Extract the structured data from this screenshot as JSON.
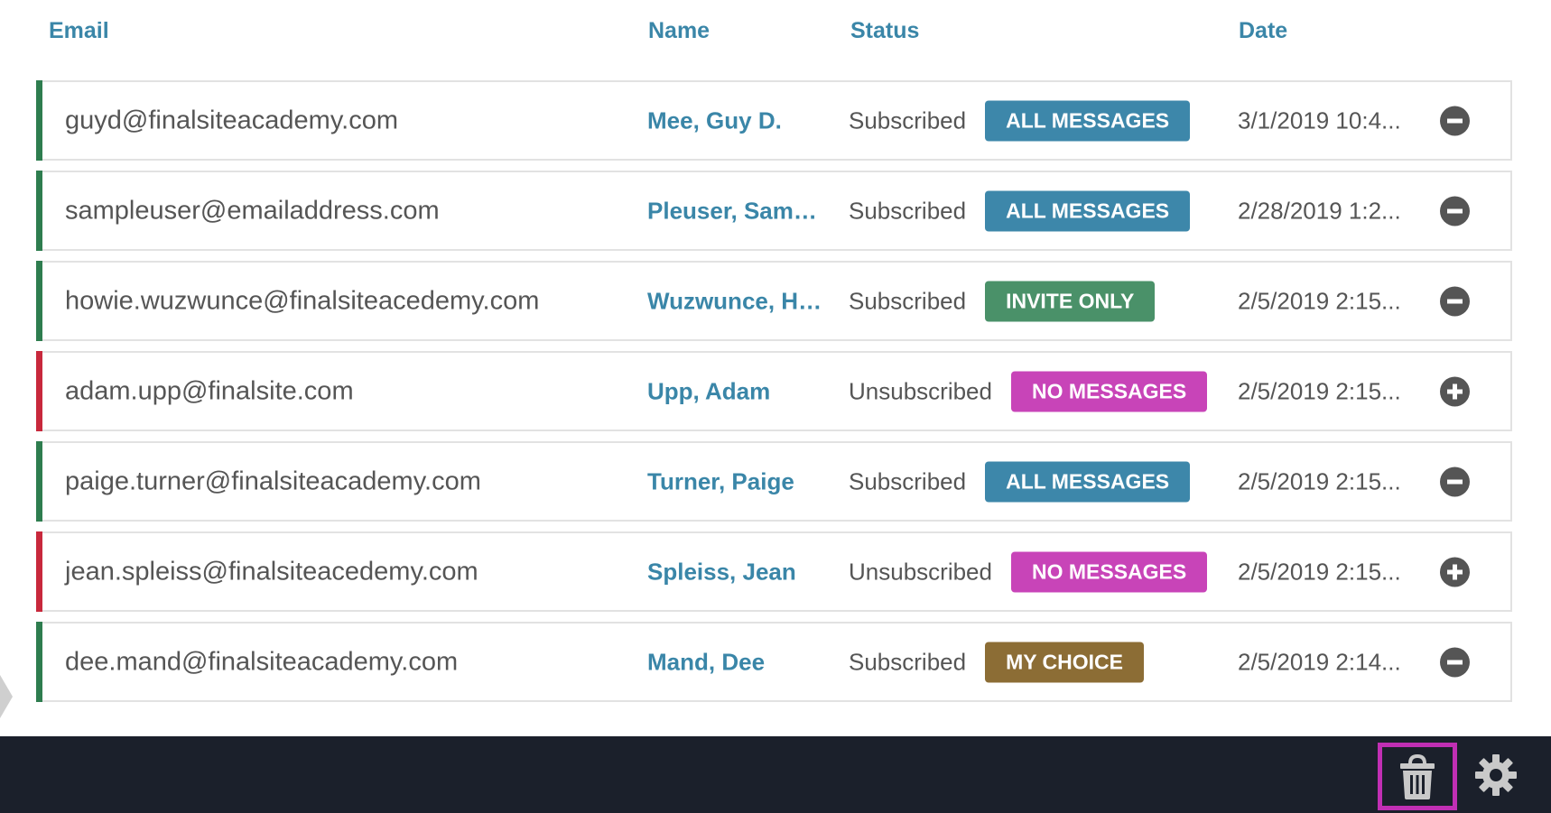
{
  "table": {
    "headers": {
      "email": "Email",
      "name": "Name",
      "status": "Status",
      "date": "Date"
    },
    "rows": [
      {
        "email": "guyd@finalsiteacademy.com",
        "name": "Mee, Guy D.",
        "status": "Subscribed",
        "badge": "ALL MESSAGES",
        "badge_color": "#3d87aa",
        "date": "3/1/2019 10:4...",
        "bar_color": "#2e7d4f",
        "action": "minus-circle-icon"
      },
      {
        "email": "sampleuser@emailaddress.com",
        "name": "Pleuser, Saman...",
        "status": "Subscribed",
        "badge": "ALL MESSAGES",
        "badge_color": "#3d87aa",
        "date": "2/28/2019 1:2...",
        "bar_color": "#2e7d4f",
        "action": "minus-circle-icon"
      },
      {
        "email": "howie.wuzwunce@finalsiteacedemy.com",
        "name": "Wuzwunce, Ho...",
        "status": "Subscribed",
        "badge": "INVITE ONLY",
        "badge_color": "#4a9169",
        "date": "2/5/2019 2:15...",
        "bar_color": "#2e7d4f",
        "action": "minus-circle-icon"
      },
      {
        "email": "adam.upp@finalsite.com",
        "name": "Upp, Adam",
        "status": "Unsubscribed",
        "badge": "NO MESSAGES",
        "badge_color": "#c844b8",
        "date": "2/5/2019 2:15...",
        "bar_color": "#c8283c",
        "action": "plus-circle-icon"
      },
      {
        "email": "paige.turner@finalsiteacademy.com",
        "name": "Turner, Paige",
        "status": "Subscribed",
        "badge": "ALL MESSAGES",
        "badge_color": "#3d87aa",
        "date": "2/5/2019 2:15...",
        "bar_color": "#2e7d4f",
        "action": "minus-circle-icon"
      },
      {
        "email": "jean.spleiss@finalsiteacedemy.com",
        "name": "Spleiss, Jean",
        "status": "Unsubscribed",
        "badge": "NO MESSAGES",
        "badge_color": "#c844b8",
        "date": "2/5/2019 2:15...",
        "bar_color": "#c8283c",
        "action": "plus-circle-icon"
      },
      {
        "email": "dee.mand@finalsiteacademy.com",
        "name": "Mand, Dee",
        "status": "Subscribed",
        "badge": "MY CHOICE",
        "badge_color": "#8c6d35",
        "date": "2/5/2019 2:14...",
        "bar_color": "#2e7d4f",
        "action": "minus-circle-icon"
      }
    ]
  },
  "footer": {
    "trash_icon": "trash-icon",
    "gear_icon": "gear-icon",
    "highlight_color": "#c12fb4",
    "background": "#1b202b"
  }
}
